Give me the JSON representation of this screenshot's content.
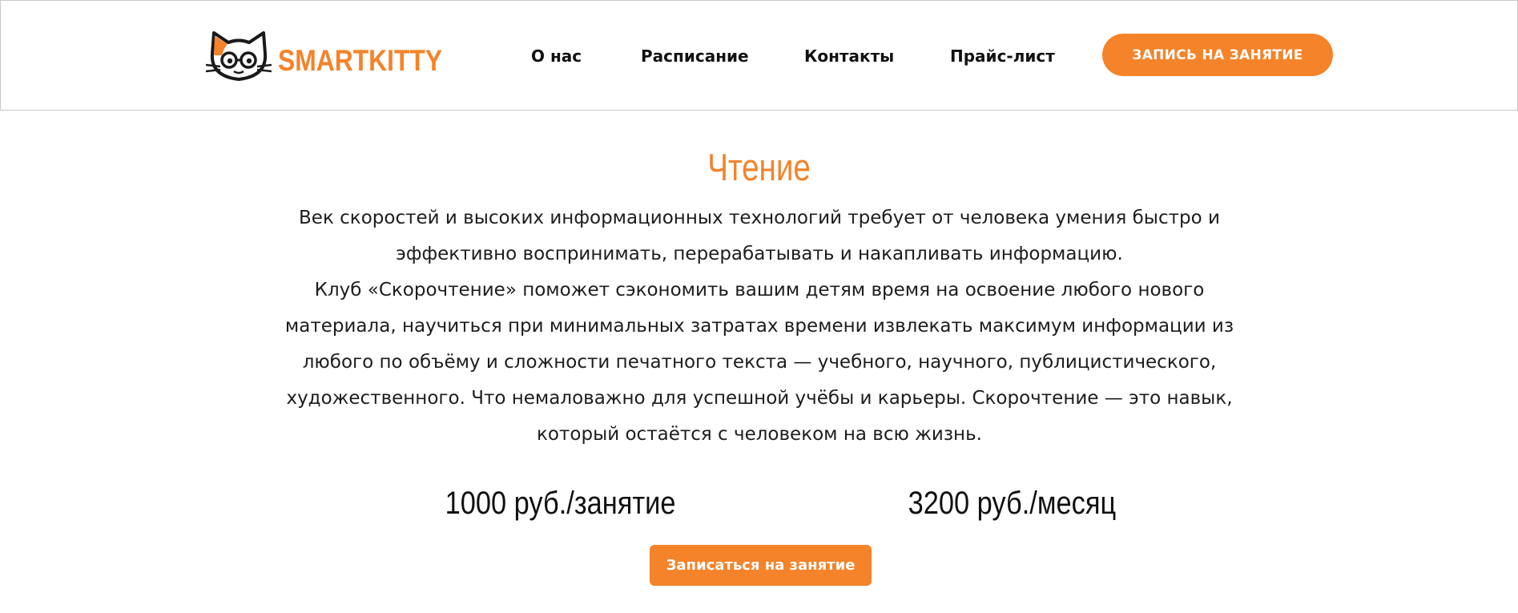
{
  "colors": {
    "accent": "#f4832a",
    "text": "#1d1d1d",
    "border": "#c9c9c9"
  },
  "header": {
    "logo_text": "SMARTKITTY",
    "logo_icon": "cat-with-glasses-icon",
    "nav": [
      {
        "label": "О нас"
      },
      {
        "label": "Расписание"
      },
      {
        "label": "Контакты"
      },
      {
        "label": "Прайс-лист"
      }
    ],
    "cta_label": "ЗАПИСЬ НА ЗАНЯТИЕ"
  },
  "main": {
    "title": "Чтение",
    "paragraph_1": "Век скоростей и высоких информационных технологий требует от человека умения быстро и эффективно воспринимать, перерабатывать и накапливать информацию.",
    "paragraph_2": "Клуб «Скорочтение» поможет сэкономить вашим детям время на освоение любого нового материала, научиться при минимальных затратах времени извлекать максимум информации из любого по объёму и сложности печатного текста — учебного, научного, публицистического, художественного. Что немаловажно для успешной учёбы и карьеры. Скорочтение — это навык, который остаётся с человеком на всю жизнь.",
    "price_per_lesson": "1000 руб./занятие",
    "price_per_month": "3200 руб./месяц",
    "signup_label": "Записаться на занятие"
  }
}
